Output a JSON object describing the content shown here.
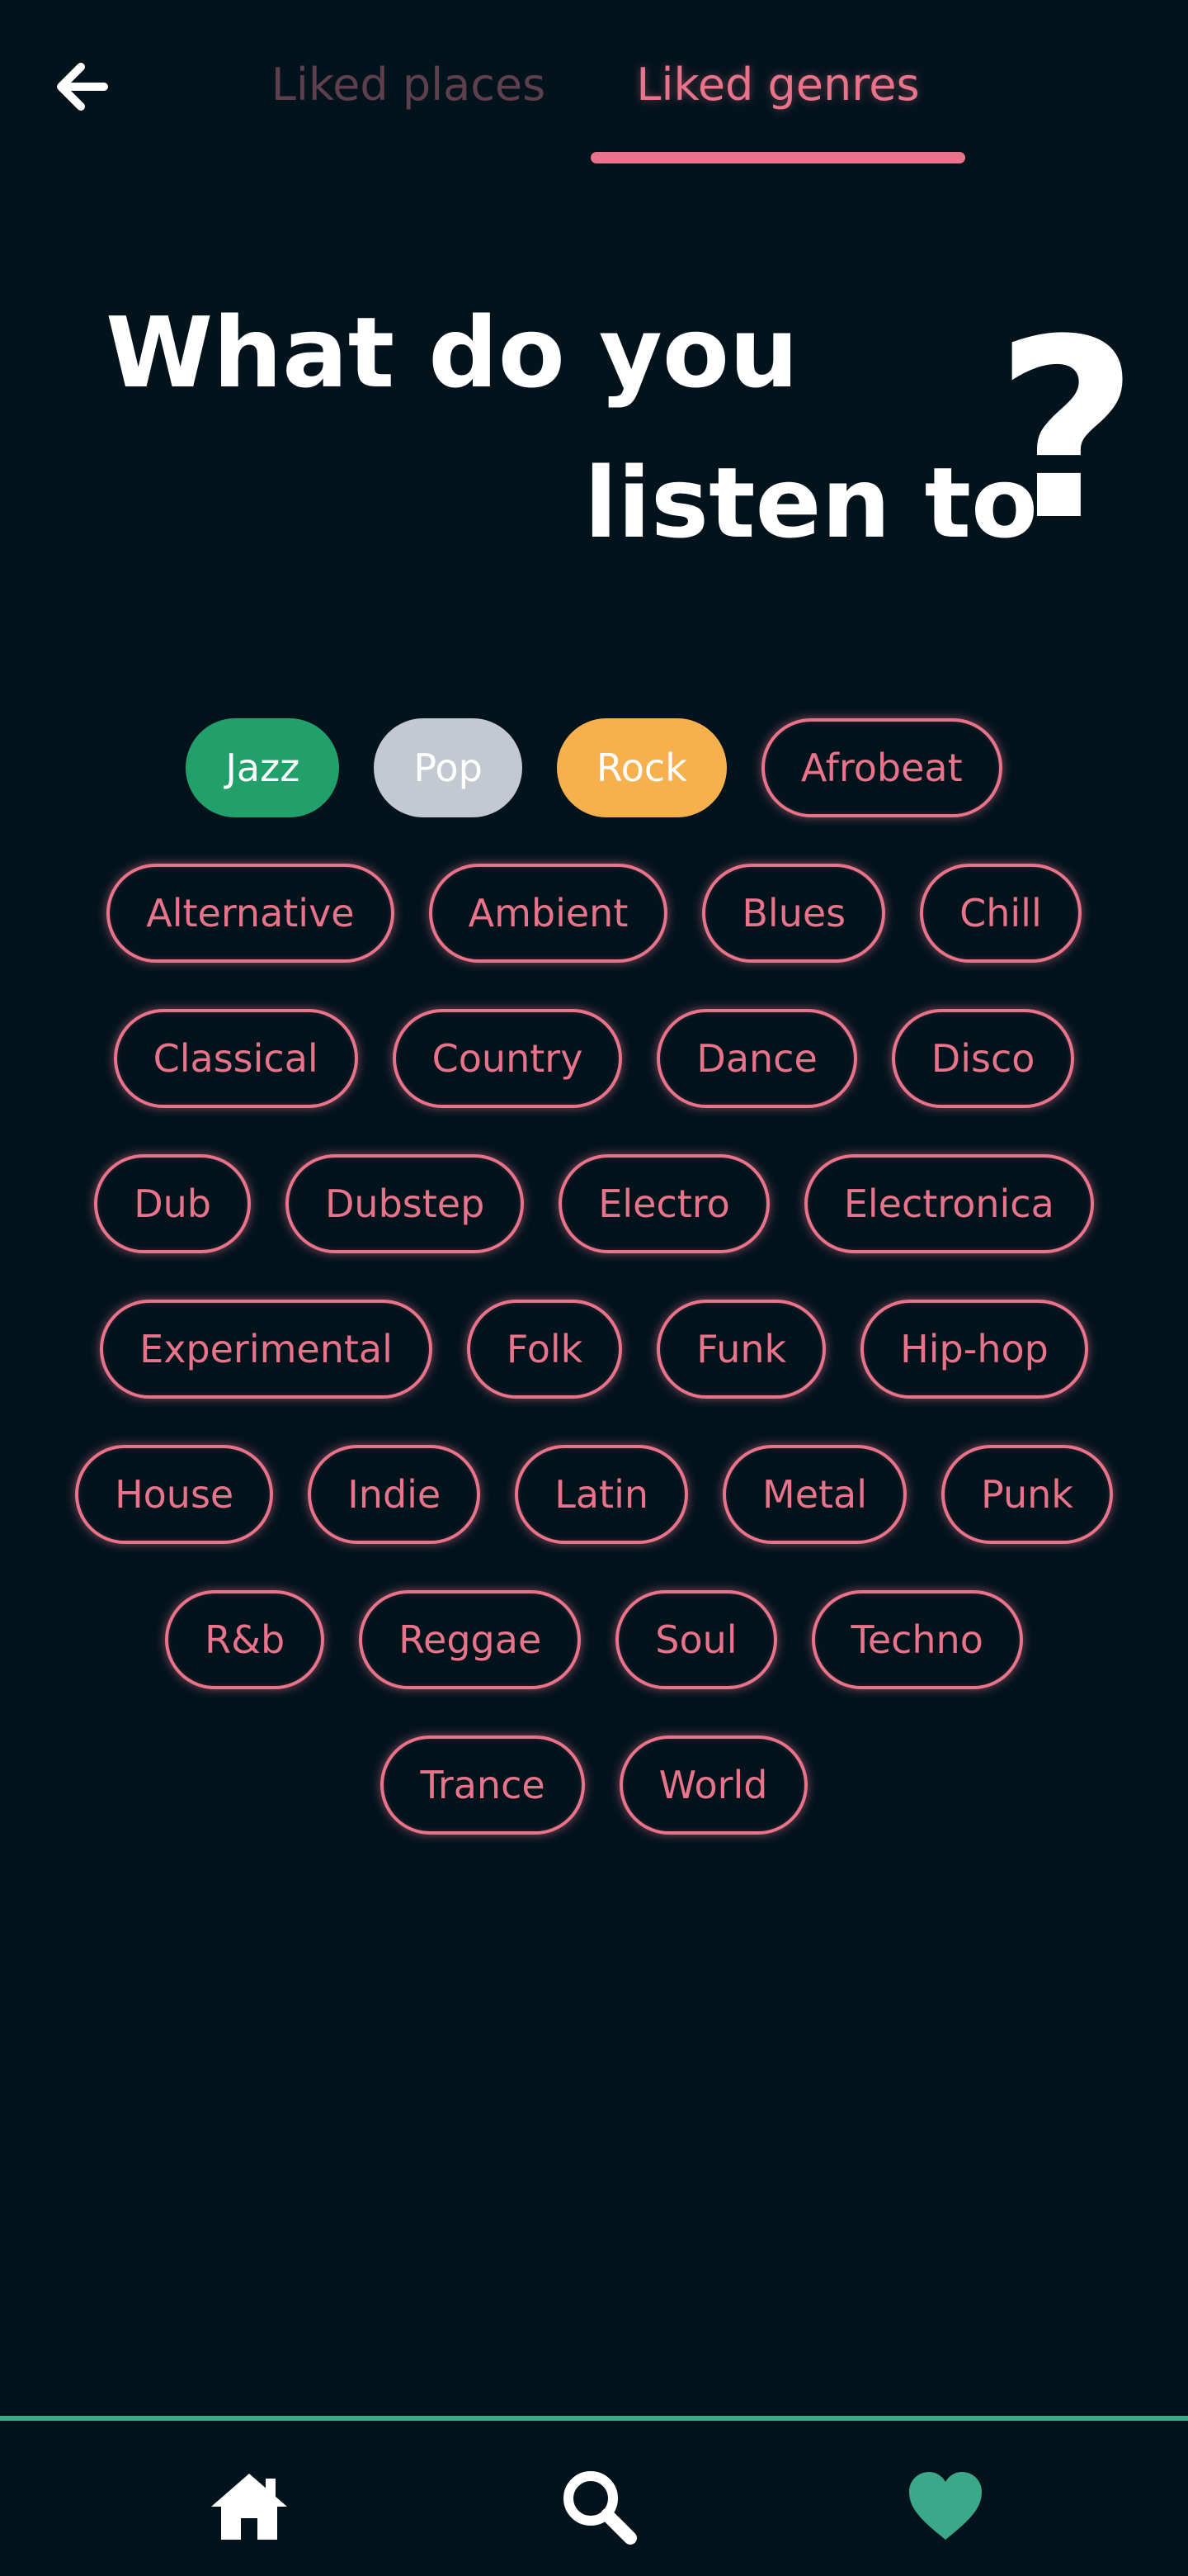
{
  "header": {
    "tabs": [
      {
        "label": "Liked places",
        "active": false
      },
      {
        "label": "Liked genres",
        "active": true
      }
    ],
    "back_icon": "arrow-left-icon"
  },
  "heading": {
    "line1": "What do you",
    "line2": "listen to",
    "question_mark": "?"
  },
  "genres": {
    "rows": [
      [
        {
          "label": "Jazz",
          "selected": true,
          "color": "#22a06b"
        },
        {
          "label": "Pop",
          "selected": true,
          "color": "#c3c8d1"
        },
        {
          "label": "Rock",
          "selected": true,
          "color": "#f6b14e"
        },
        {
          "label": "Afrobeat",
          "selected": false
        }
      ],
      [
        {
          "label": "Alternative",
          "selected": false
        },
        {
          "label": "Ambient",
          "selected": false
        },
        {
          "label": "Blues",
          "selected": false
        },
        {
          "label": "Chill",
          "selected": false
        }
      ],
      [
        {
          "label": "Classical",
          "selected": false
        },
        {
          "label": "Country",
          "selected": false
        },
        {
          "label": "Dance",
          "selected": false
        },
        {
          "label": "Disco",
          "selected": false
        }
      ],
      [
        {
          "label": "Dub",
          "selected": false
        },
        {
          "label": "Dubstep",
          "selected": false
        },
        {
          "label": "Electro",
          "selected": false
        },
        {
          "label": "Electronica",
          "selected": false
        }
      ],
      [
        {
          "label": "Experimental",
          "selected": false
        },
        {
          "label": "Folk",
          "selected": false
        },
        {
          "label": "Funk",
          "selected": false
        },
        {
          "label": "Hip-hop",
          "selected": false
        }
      ],
      [
        {
          "label": "House",
          "selected": false
        },
        {
          "label": "Indie",
          "selected": false
        },
        {
          "label": "Latin",
          "selected": false
        },
        {
          "label": "Metal",
          "selected": false
        },
        {
          "label": "Punk",
          "selected": false
        }
      ],
      [
        {
          "label": "R&b",
          "selected": false
        },
        {
          "label": "Reggae",
          "selected": false
        },
        {
          "label": "Soul",
          "selected": false
        },
        {
          "label": "Techno",
          "selected": false
        }
      ],
      [
        {
          "label": "Trance",
          "selected": false
        },
        {
          "label": "World",
          "selected": false
        }
      ]
    ]
  },
  "bottom_nav": {
    "items": [
      {
        "icon": "home-icon",
        "active": false
      },
      {
        "icon": "search-icon",
        "active": false
      },
      {
        "icon": "heart-icon",
        "active": true
      }
    ]
  },
  "colors": {
    "background": "#03131c",
    "accent_pink": "#e8738a",
    "inactive_tab": "#5e3f4d",
    "accent_green": "#3aa889",
    "icon_white": "#ffffff"
  }
}
